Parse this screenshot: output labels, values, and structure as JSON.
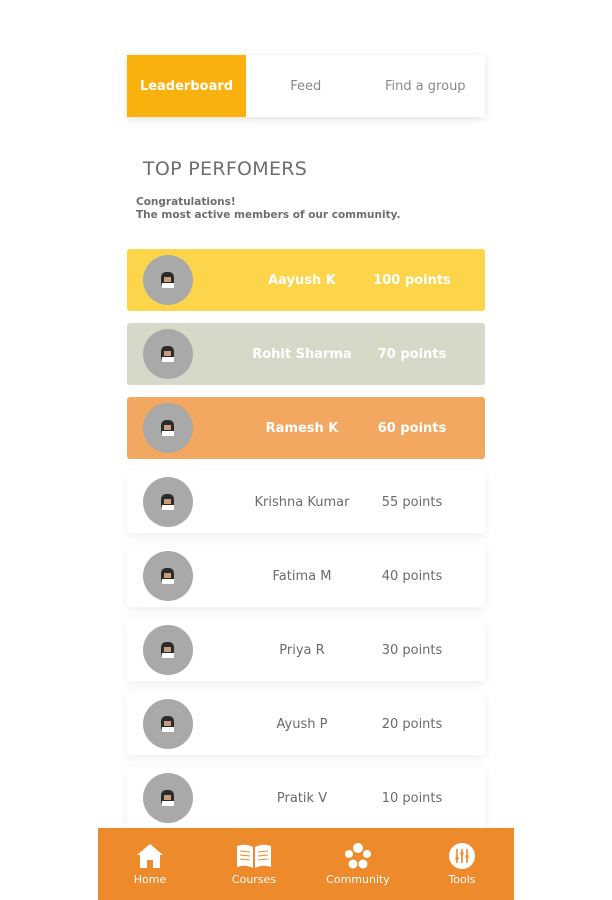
{
  "tabs": [
    {
      "label": "Leaderboard",
      "active": true
    },
    {
      "label": "Feed",
      "active": false
    },
    {
      "label": "Find a group",
      "active": false
    }
  ],
  "title": "TOP PERFOMERS",
  "subtitle_line1": "Congratulations!",
  "subtitle_line2": "The most active members of our community.",
  "members": [
    {
      "name": "Aayush K",
      "points": "100 points",
      "highlight": "#fcd54a"
    },
    {
      "name": "Rohit Sharma",
      "points": "70 points",
      "highlight": "#d7d8c8"
    },
    {
      "name": "Ramesh K",
      "points": "60 points",
      "highlight": "#f2a860"
    },
    {
      "name": "Krishna Kumar",
      "points": "55 points"
    },
    {
      "name": "Fatima M",
      "points": "40 points"
    },
    {
      "name": "Priya R",
      "points": "30 points"
    },
    {
      "name": "Ayush P",
      "points": "20 points"
    },
    {
      "name": "Pratik V",
      "points": "10 points"
    }
  ],
  "nav": [
    {
      "label": "Home",
      "icon": "home-icon"
    },
    {
      "label": "Courses",
      "icon": "book-icon"
    },
    {
      "label": "Community",
      "icon": "community-icon"
    },
    {
      "label": "Tools",
      "icon": "tools-icon"
    }
  ],
  "colors": {
    "accent": "#f9b10d",
    "nav_bg": "#ed8a2c"
  }
}
